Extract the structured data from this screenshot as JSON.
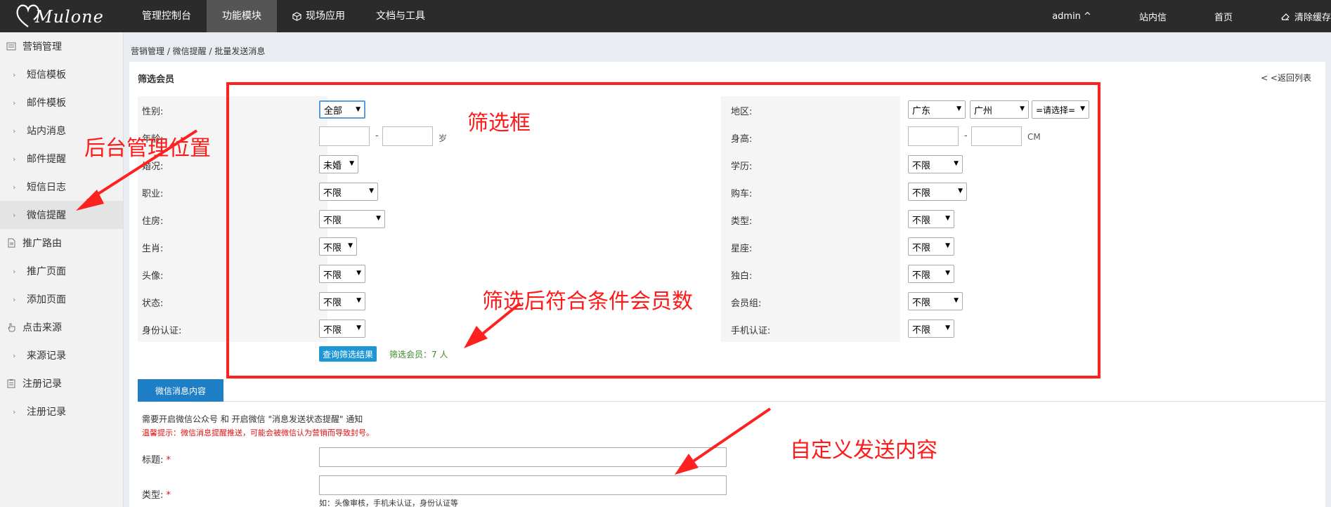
{
  "header": {
    "logo_text": "Mulone",
    "nav": [
      {
        "label": "管理控制台",
        "active": false,
        "icon": ""
      },
      {
        "label": "功能模块",
        "active": true,
        "icon": ""
      },
      {
        "label": "现场应用",
        "active": false,
        "icon": "cube-icon"
      },
      {
        "label": "文档与工具",
        "active": false,
        "icon": ""
      }
    ],
    "user": "admin ^",
    "station_msg": "站内信",
    "home": "首页",
    "clear_cache": "清除缓存"
  },
  "sidebar": {
    "groups": [
      {
        "label": "营销管理",
        "icon": "list-icon",
        "items": [
          "短信模板",
          "邮件模板",
          "站内消息",
          "邮件提醒",
          "短信日志",
          "微信提醒"
        ]
      },
      {
        "label": "推广路由",
        "icon": "document-icon",
        "items": [
          "推广页面",
          "添加页面"
        ]
      },
      {
        "label": "点击来源",
        "icon": "hand-icon",
        "items": [
          "来源记录"
        ]
      },
      {
        "label": "注册记录",
        "icon": "clipboard-icon",
        "items": [
          "注册记录"
        ]
      }
    ],
    "active_item": "微信提醒"
  },
  "breadcrumb": "营销管理 / 微信提醒 / 批量发送消息",
  "panel": {
    "title": "筛选会员",
    "back_link": "< <返回列表"
  },
  "filters": {
    "gender": {
      "label": "性别:",
      "value": "全部"
    },
    "age": {
      "label": "年龄:",
      "dash": "-",
      "unit": "岁"
    },
    "marital": {
      "label": "婚况:",
      "value": "未婚"
    },
    "job": {
      "label": "职业:",
      "value": "不限"
    },
    "housing": {
      "label": "住房:",
      "value": "不限"
    },
    "zodiac": {
      "label": "生肖:",
      "value": "不限"
    },
    "avatar": {
      "label": "头像:",
      "value": "不限"
    },
    "status": {
      "label": "状态:",
      "value": "不限"
    },
    "id_verify": {
      "label": "身份认证:",
      "value": "不限"
    },
    "region": {
      "label": "地区:",
      "province": "广东",
      "city": "广州",
      "district": "=请选择="
    },
    "height": {
      "label": "身高:",
      "dash": "-",
      "unit": "CM"
    },
    "education": {
      "label": "学历:",
      "value": "不限"
    },
    "car": {
      "label": "购车:",
      "value": "不限"
    },
    "type": {
      "label": "类型:",
      "value": "不限"
    },
    "constellation": {
      "label": "星座:",
      "value": "不限"
    },
    "monologue": {
      "label": "独白:",
      "value": "不限"
    },
    "member_group": {
      "label": "会员组:",
      "value": "不限"
    },
    "phone_verify": {
      "label": "手机认证:",
      "value": "不限"
    }
  },
  "query_button": "查询筛选结果",
  "result_count": "筛选会员：7 人",
  "message": {
    "tab": "微信消息内容",
    "note1": "需要开启微信公众号 和 开启微信 \"消息发送状态提醒\" 通知",
    "note2": "温馨提示：微信消息提醒推送，可能会被微信认为营销而导致封号。",
    "title_label": "标题:",
    "type_label": "类型:",
    "required_mark": "*",
    "type_hint": "如：头像审核，手机未认证，身份认证等"
  },
  "annotations": {
    "filter_box": "筛选框",
    "admin_location": "后台管理位置",
    "member_count": "筛选后符合条件会员数",
    "custom_content": "自定义发送内容",
    "color": "#ff1a1a"
  },
  "colors": {
    "topbar": "#2b2b2b",
    "accent": "#1e7fc6",
    "annotation": "#ff2020"
  }
}
